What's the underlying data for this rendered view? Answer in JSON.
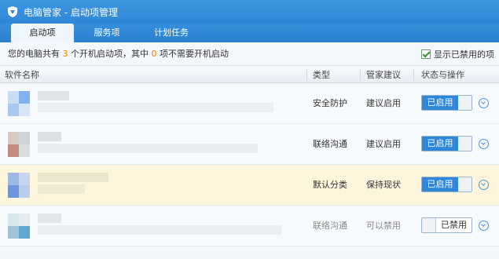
{
  "window": {
    "title": "电脑管家 - 启动项管理"
  },
  "tabs": [
    {
      "label": "启动项",
      "active": true
    },
    {
      "label": "服务项",
      "active": false
    },
    {
      "label": "计划任务",
      "active": false
    }
  ],
  "summary": {
    "prefix": "您的电脑共有 ",
    "count_total": "3",
    "mid": " 个开机启动项，其中 ",
    "count_unneeded": "0",
    "suffix": " 项不需要开机启动"
  },
  "show_disabled": {
    "label": "显示已禁用的项",
    "checked": true
  },
  "table": {
    "headers": {
      "name": "软件名称",
      "type": "类型",
      "advice": "管家建议",
      "state": "状态与操作"
    },
    "rows": [
      {
        "type": "安全防护",
        "advice": "建议启用",
        "state": "已启用",
        "enabled": true
      },
      {
        "type": "联络沟通",
        "advice": "建议启用",
        "state": "已启用",
        "enabled": true
      },
      {
        "type": "默认分类",
        "advice": "保持现状",
        "state": "已启用",
        "enabled": true
      },
      {
        "type": "联络沟通",
        "advice": "可以禁用",
        "state": "已禁用",
        "enabled": false
      }
    ]
  },
  "colors": {
    "titlebar": "#2f86d6",
    "accent_orange": "#f08300",
    "enabled_button": "#2f87d8",
    "highlight_row": "#fdf6dd"
  }
}
